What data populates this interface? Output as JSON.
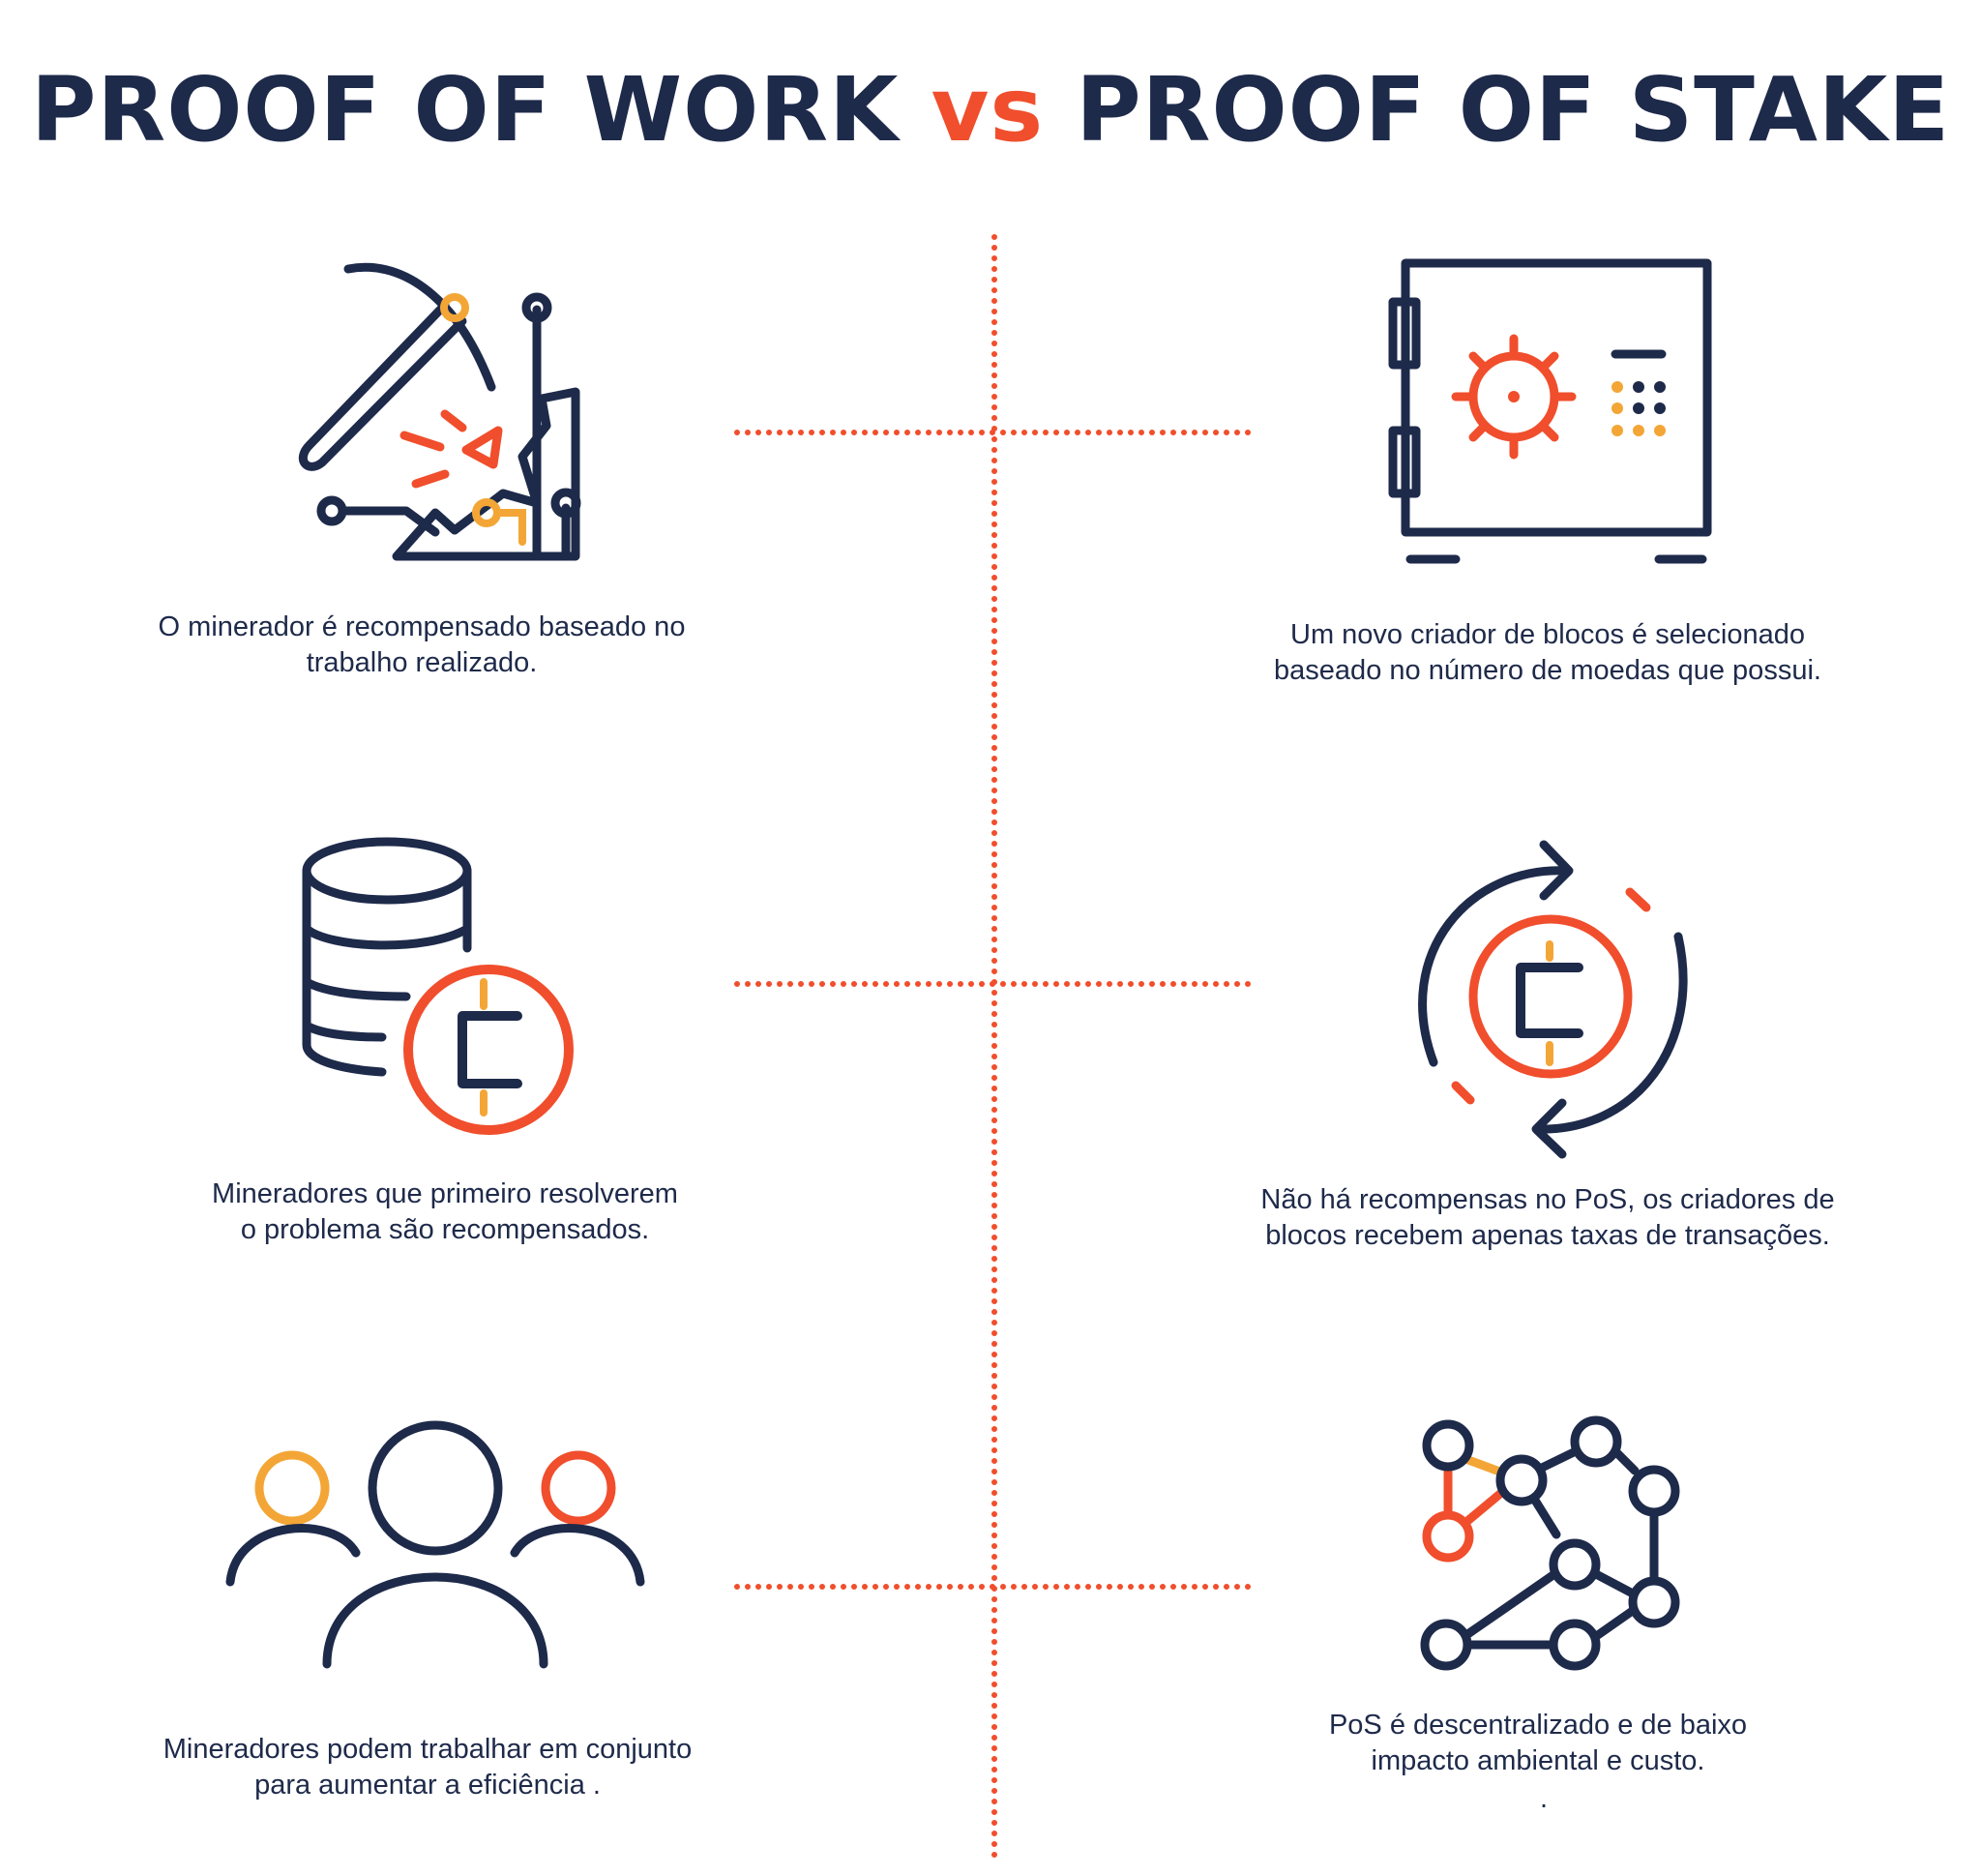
{
  "title": {
    "left": "PROOF OF WORK",
    "vs": "vs",
    "right": "PROOF OF STAKE"
  },
  "colors": {
    "navy": "#1e2a4a",
    "orange_red": "#f04e2c",
    "amber": "#f3a636"
  },
  "pow": {
    "items": [
      {
        "icon": "pickaxe-mining-icon",
        "lines": [
          "O minerador é recompensado baseado no",
          "trabalho realizado."
        ]
      },
      {
        "icon": "coin-stack-icon",
        "lines": [
          "Mineradores que primeiro resolverem",
          "o problema são recompensados."
        ]
      },
      {
        "icon": "people-group-icon",
        "lines": [
          "Mineradores podem trabalhar em conjunto",
          "para aumentar a eficiência ."
        ]
      }
    ]
  },
  "pos": {
    "items": [
      {
        "icon": "safe-vault-icon",
        "lines": [
          "Um novo criador de blocos é selecionado",
          "baseado no número de moedas que possui."
        ]
      },
      {
        "icon": "coin-cycle-icon",
        "lines": [
          "Não há recompensas no PoS, os criadores de",
          "blocos recebem apenas taxas de transações."
        ]
      },
      {
        "icon": "network-nodes-icon",
        "lines": [
          "PoS é descentralizado e de baixo",
          "impacto ambiental e custo.",
          "."
        ]
      }
    ]
  }
}
